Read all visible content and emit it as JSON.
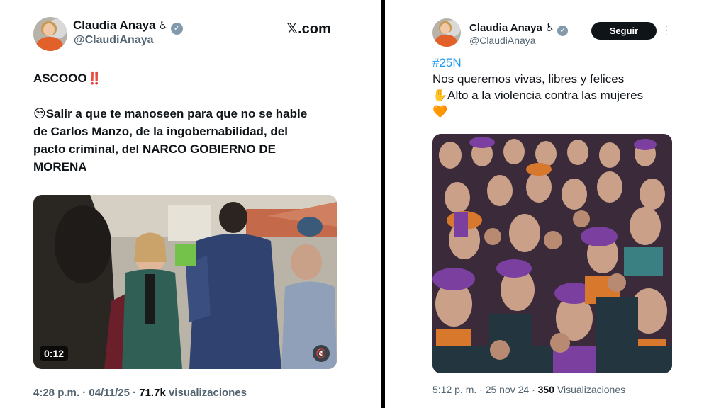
{
  "left_tweet": {
    "author": {
      "name": "Claudia Anaya",
      "handle": "@ClaudiAnaya",
      "verified": true,
      "name_emoji": "♿"
    },
    "source": "𝕏.com",
    "text_lines": [
      "ASCOOO‼️",
      "",
      "😒Salir a que te manoseen para que no se hable",
      "de Carlos Manzo, de la ingobernabilidad, del",
      "pacto criminal, del NARCO GOBIERNO DE",
      "MORENA"
    ],
    "video": {
      "duration": "0:12",
      "icon": "mute-icon"
    },
    "footer": {
      "time": "4:28 p.m. · 04/11/25 · ",
      "views_count": "71.7k",
      "views_label": " visualizaciones"
    }
  },
  "right_tweet": {
    "author": {
      "name": "Claudia Anaya",
      "handle": "@ClaudiAnaya",
      "verified": true,
      "name_emoji": "♿"
    },
    "follow_label": "Seguir",
    "more_icon": "more-options-icon",
    "hashtag": "#25N",
    "lines": [
      "Nos queremos vivas, libres y felices",
      "✋Alto a la violencia contra las mujeres",
      "🧡"
    ],
    "footer": {
      "time": "5:12 p. m. · 25 nov 24 · ",
      "views_count": "350",
      "views_label": " Visualizaciones"
    }
  },
  "colors": {
    "accent": "#1d9bf0",
    "text": "#0f1419",
    "muted": "#536471",
    "divider": "#000000"
  }
}
